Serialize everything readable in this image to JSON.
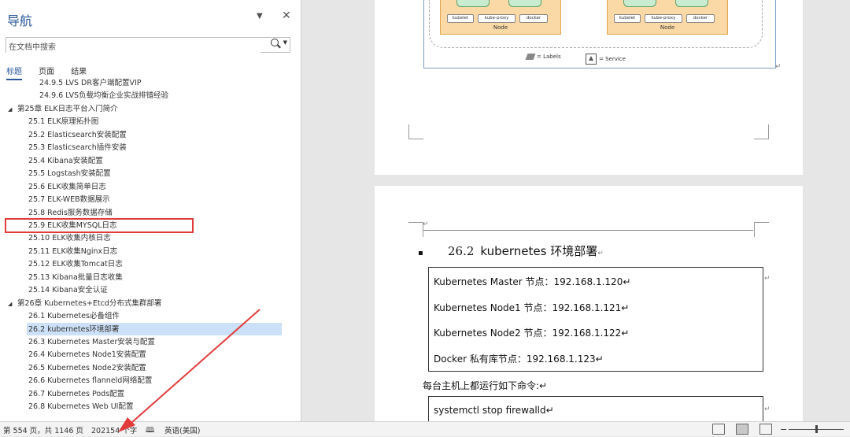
{
  "nav": {
    "title": "导航",
    "dropdown_glyph": "▼",
    "close_glyph": "✕",
    "search_placeholder": "在文档中搜索",
    "tabs": [
      "标题",
      "页面",
      "结果"
    ],
    "toc": [
      {
        "text": "24.9.5  LVS DR客户端配置VIP",
        "level": 3
      },
      {
        "text": "24.9.6  LVS负载均衡企业实战排错经验",
        "level": 3
      },
      {
        "text": "第25章  ELK日志平台入门简介",
        "level": 1,
        "expanded": true
      },
      {
        "text": "25.1  ELK原理拓扑图",
        "level": 2
      },
      {
        "text": "25.2  Elasticsearch安装配置",
        "level": 2
      },
      {
        "text": "25.3  Elasticsearch插件安装",
        "level": 2
      },
      {
        "text": "25.4  Kibana安装配置",
        "level": 2
      },
      {
        "text": "25.5  Logstash安装配置",
        "level": 2
      },
      {
        "text": "25.6  ELK收集简单日志",
        "level": 2
      },
      {
        "text": "25.7  ELK-WEB数据展示",
        "level": 2
      },
      {
        "text": "25.8  Redis服务数据存储",
        "level": 2
      },
      {
        "text": "25.9  ELK收集MYSQL日志",
        "level": 2
      },
      {
        "text": "25.10  ELK收集内核日志",
        "level": 2
      },
      {
        "text": "25.11  ELK收集Nginx日志",
        "level": 2
      },
      {
        "text": "25.12  ELK收集Tomcat日志",
        "level": 2
      },
      {
        "text": "25.13  Kibana批量日志收集",
        "level": 2
      },
      {
        "text": "25.14  Kibana安全认证",
        "level": 2
      },
      {
        "text": "第26章  Kubernetes+Etcd分布式集群部署",
        "level": 1,
        "expanded": true
      },
      {
        "text": "26.1  Kubernetes必备组件",
        "level": 2
      },
      {
        "text": "26.2  kubernetes环境部署",
        "level": 2,
        "selected": true
      },
      {
        "text": "26.3  Kubernetes Master安装与配置",
        "level": 2
      },
      {
        "text": "26.4  Kubernetes Node1安装配置",
        "level": 2
      },
      {
        "text": "26.5  Kubernetes Node2安装配置",
        "level": 2
      },
      {
        "text": "26.6  Kubernetes flanneld网络配置",
        "level": 2
      },
      {
        "text": "26.7  Kubernetes Pods配置",
        "level": 2
      },
      {
        "text": "26.8  Kubernetes Web UI配置",
        "level": 2
      }
    ]
  },
  "doc": {
    "diagram": {
      "nodes": [
        {
          "label": "Node",
          "pills": [
            "kubelet",
            "kube-proxy",
            "docker"
          ]
        },
        {
          "label": "Node",
          "pills": [
            "kubelet",
            "kube-proxy",
            "docker"
          ]
        }
      ],
      "legend_labels": "= Labels",
      "legend_service": "= Service"
    },
    "heading_bullet": "▪",
    "heading_num": "26.2",
    "heading_text": "kubernetes 环境部署",
    "heading_mark": "↵",
    "box1": [
      "Kubernetes Master 节点：192.168.1.120↵",
      "Kubernetes Node1 节点：192.168.1.121↵",
      "Kubernetes Node2 节点：192.168.1.122↵",
      "Docker 私有库节点：192.168.1.123↵"
    ],
    "plain": "每台主机上都运行如下命令:↵",
    "box2": [
      "systemctl stop firewalld↵"
    ],
    "para_mark": "↵"
  },
  "status": {
    "page": "第 554 页，共 1146 页",
    "words": "202154 个字",
    "language": "英语(美国)",
    "zoom_minus": "−"
  },
  "colors": {
    "accent": "#2b579a",
    "selection": "#cce0f7",
    "highlight_red": "#e23b3b"
  }
}
